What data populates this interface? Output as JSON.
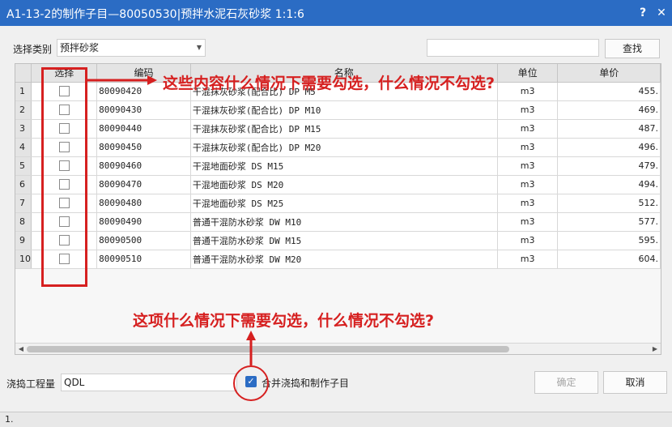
{
  "window": {
    "title": "A1-13-2的制作子目—80050530|预拌水泥石灰砂浆 1:1:6",
    "help_label": "?",
    "close_label": "✕"
  },
  "toolbar": {
    "category_label": "选择类别",
    "category_value": "预拌砂浆",
    "search_value": "",
    "find_label": "查找"
  },
  "grid": {
    "columns": [
      "选择",
      "编码",
      "名称",
      "单位",
      "单价"
    ],
    "rows": [
      {
        "num": "1",
        "code": "80090420",
        "name": "干混抹灰砂浆(配合比) DP M5",
        "unit": "m3",
        "price": "455."
      },
      {
        "num": "2",
        "code": "80090430",
        "name": "干混抹灰砂浆(配合比) DP M10",
        "unit": "m3",
        "price": "469."
      },
      {
        "num": "3",
        "code": "80090440",
        "name": "干混抹灰砂浆(配合比) DP M15",
        "unit": "m3",
        "price": "487."
      },
      {
        "num": "4",
        "code": "80090450",
        "name": "干混抹灰砂浆(配合比) DP M20",
        "unit": "m3",
        "price": "496."
      },
      {
        "num": "5",
        "code": "80090460",
        "name": "干混地面砂浆 DS M15",
        "unit": "m3",
        "price": "479."
      },
      {
        "num": "6",
        "code": "80090470",
        "name": "干混地面砂浆 DS M20",
        "unit": "m3",
        "price": "494."
      },
      {
        "num": "7",
        "code": "80090480",
        "name": "干混地面砂浆 DS M25",
        "unit": "m3",
        "price": "512."
      },
      {
        "num": "8",
        "code": "80090490",
        "name": "普通干混防水砂浆 DW M10",
        "unit": "m3",
        "price": "577."
      },
      {
        "num": "9",
        "code": "80090500",
        "name": "普通干混防水砂浆 DW M15",
        "unit": "m3",
        "price": "595."
      },
      {
        "num": "10",
        "code": "80090510",
        "name": "普通干混防水砂浆 DW M20",
        "unit": "m3",
        "price": "604."
      }
    ]
  },
  "bottom": {
    "qty_label": "浇捣工程量",
    "qty_value": "QDL",
    "merge_label": "合并浇捣和制作子目",
    "merge_checked": true,
    "ok_label": "确定",
    "cancel_label": "取消"
  },
  "strip": {
    "num": "1."
  },
  "annotations": {
    "top_question": "这些内容什么情况下需要勾选，什么情况不勾选?",
    "bottom_question": "这项什么情况下需要勾选，什么情况不勾选?",
    "color": "#d62020"
  },
  "colors": {
    "titlebar": "#2b6cc4",
    "accent": "#2b6cc4"
  }
}
